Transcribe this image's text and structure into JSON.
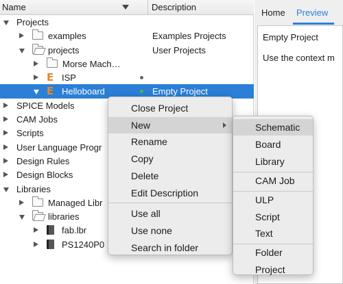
{
  "header": {
    "name": "Name",
    "description": "Description"
  },
  "tree": [
    {
      "label": "Projects",
      "desc": "",
      "level": 0,
      "expanded": true,
      "icon": "none"
    },
    {
      "label": "examples",
      "desc": "Examples Projects",
      "level": 1,
      "expanded": false,
      "icon": "folder"
    },
    {
      "label": "projects",
      "desc": "User Projects",
      "level": 1,
      "expanded": true,
      "icon": "folder-open"
    },
    {
      "label": "Morse Mach…",
      "desc": "",
      "level": 2,
      "expanded": false,
      "icon": "folder"
    },
    {
      "label": "ISP",
      "desc": "",
      "level": 2,
      "expanded": false,
      "icon": "eagle",
      "dot": "gray"
    },
    {
      "label": "Helloboard",
      "desc": "Empty Project",
      "level": 2,
      "expanded": true,
      "icon": "eagle",
      "dot": "green",
      "selected": true
    },
    {
      "label": "SPICE Models",
      "desc": "",
      "level": 0,
      "expanded": false,
      "icon": "none"
    },
    {
      "label": "CAM Jobs",
      "desc": "",
      "level": 0,
      "expanded": false,
      "icon": "none"
    },
    {
      "label": "Scripts",
      "desc": "",
      "level": 0,
      "expanded": false,
      "icon": "none"
    },
    {
      "label": "User Language Progr",
      "desc": "",
      "level": 0,
      "expanded": false,
      "icon": "none"
    },
    {
      "label": "Design Rules",
      "desc": "",
      "level": 0,
      "expanded": false,
      "icon": "none"
    },
    {
      "label": "Design Blocks",
      "desc": "",
      "level": 0,
      "expanded": false,
      "icon": "none"
    },
    {
      "label": "Libraries",
      "desc": "",
      "level": 0,
      "expanded": true,
      "icon": "none"
    },
    {
      "label": "Managed Libr",
      "desc": "",
      "level": 1,
      "expanded": false,
      "icon": "folder"
    },
    {
      "label": "libraries",
      "desc": "",
      "level": 1,
      "expanded": true,
      "icon": "folder-open"
    },
    {
      "label": "fab.lbr",
      "desc": "",
      "level": 2,
      "expanded": false,
      "icon": "libfile"
    },
    {
      "label": "PS1240P0",
      "desc": "",
      "level": 2,
      "expanded": false,
      "icon": "libfile"
    }
  ],
  "right_panel": {
    "tabs": [
      "Home",
      "Preview"
    ],
    "active_tab": "Preview",
    "preview_title": "Empty Project",
    "preview_text": "Use the context m"
  },
  "context_menu": {
    "groups": [
      [
        "Close Project",
        "New",
        "Rename",
        "Copy",
        "Delete",
        "Edit Description"
      ],
      [
        "Use all",
        "Use none",
        "Search in folder"
      ]
    ],
    "highlighted": "New"
  },
  "new_submenu": {
    "groups": [
      [
        "Schematic",
        "Board",
        "Library"
      ],
      [
        "CAM Job"
      ],
      [
        "ULP",
        "Script",
        "Text"
      ],
      [
        "Folder",
        "Project"
      ]
    ],
    "highlighted": "Schematic"
  },
  "colors": {
    "selection": "#2b7fd6",
    "accent": "#2b7fd6",
    "eagle_icon": "#e8862a",
    "status_green": "#3fbf3f"
  }
}
